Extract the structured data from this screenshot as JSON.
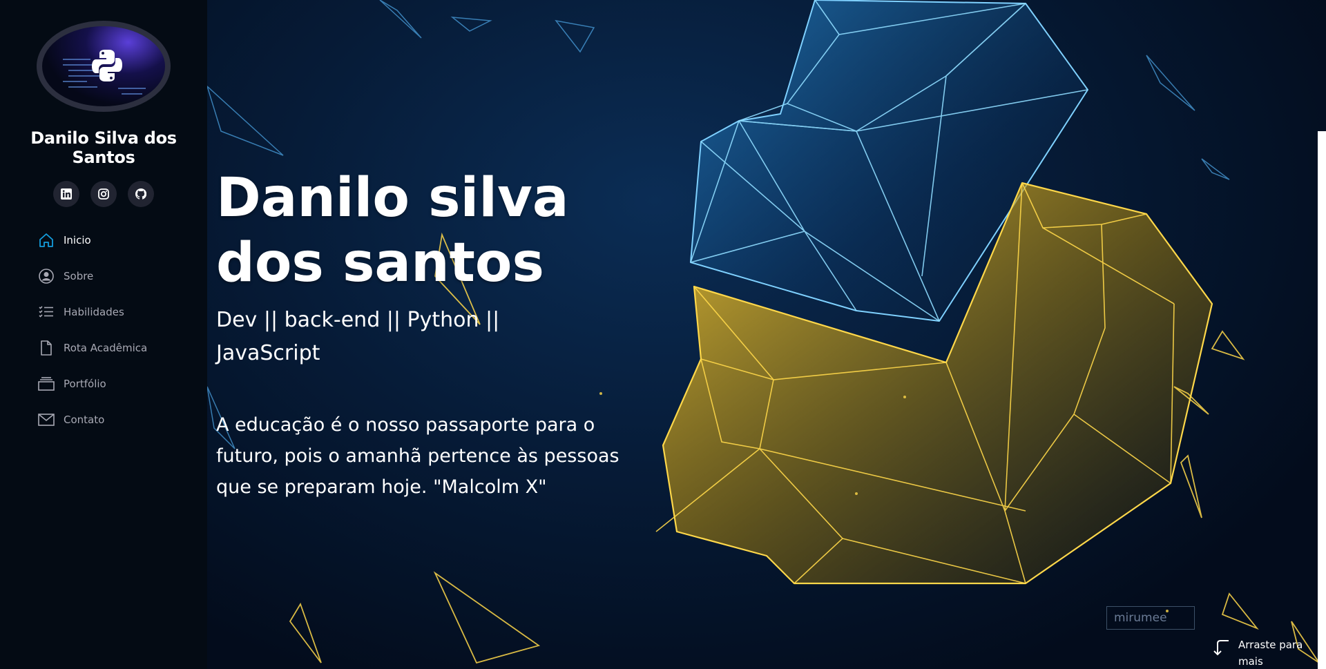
{
  "profile": {
    "name": "Danilo Silva dos Santos"
  },
  "social": [
    {
      "icon": "linkedin-icon"
    },
    {
      "icon": "instagram-icon"
    },
    {
      "icon": "github-icon"
    }
  ],
  "nav": {
    "items": [
      {
        "label": "Inicio",
        "icon": "home-icon",
        "active": true
      },
      {
        "label": "Sobre",
        "icon": "user-icon"
      },
      {
        "label": "Habilidades",
        "icon": "list-icon"
      },
      {
        "label": "Rota Acadêmica",
        "icon": "file-icon"
      },
      {
        "label": "Portfólio",
        "icon": "stack-icon"
      },
      {
        "label": "Contato",
        "icon": "envelope-icon"
      }
    ]
  },
  "hero": {
    "title": "Danilo silva dos santos",
    "subtitle": "Dev || back-end || Python || JavaScript",
    "quote": "A educação é o nosso passaporte para o futuro, pois o amanhã pertence às pessoas que se preparam hoje. \"Malcolm X\"",
    "watermark": "mirumee",
    "scroll_hint": "Arraste para mais"
  },
  "colors": {
    "sidebar_bg": "#040b14",
    "active_nav": "#149ddd",
    "nav_text": "#a8a9b4",
    "blue_polygon": "#4fc3f7",
    "gold_polygon": "#f5c518"
  }
}
